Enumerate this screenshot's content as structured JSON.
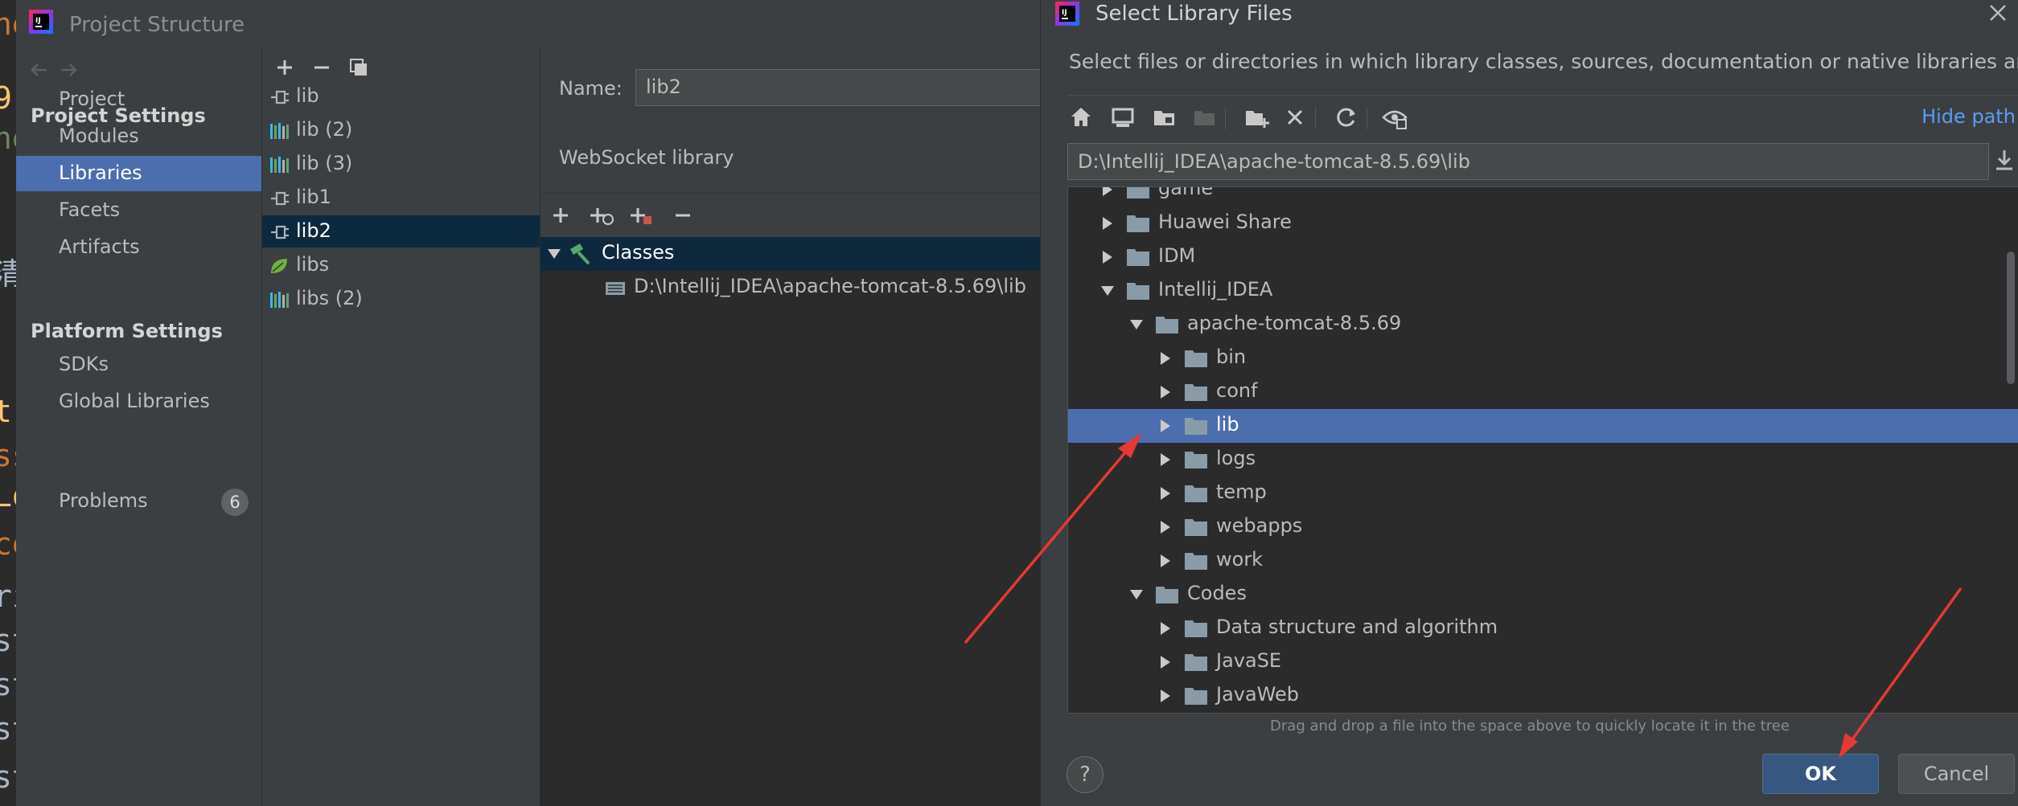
{
  "code_strip": [
    "ne",
    "9.",
    "ne",
    "清",
    "t(",
    "ss",
    "Lo",
    "ce",
    "ri",
    "st",
    "st",
    "st",
    "st"
  ],
  "project_structure": {
    "title": "Project Structure",
    "sidebar": {
      "project_settings_header": "Project Settings",
      "project_settings_items": [
        "Project",
        "Modules",
        "Libraries",
        "Facets",
        "Artifacts"
      ],
      "selected_item": "Libraries",
      "platform_settings_header": "Platform Settings",
      "platform_settings_items": [
        "SDKs",
        "Global Libraries"
      ],
      "problems_label": "Problems",
      "problems_count": "6"
    },
    "libraries": [
      {
        "label": "lib",
        "icon": "plug-icon"
      },
      {
        "label": "lib (2)",
        "icon": "library-icon"
      },
      {
        "label": "lib (3)",
        "icon": "library-icon"
      },
      {
        "label": "lib1",
        "icon": "plug-icon"
      },
      {
        "label": "lib2",
        "icon": "plug-icon"
      },
      {
        "label": "libs",
        "icon": "spring-leaf-icon"
      },
      {
        "label": "libs (2)",
        "icon": "library-icon"
      }
    ],
    "selected_library": "lib2",
    "detail": {
      "name_label": "Name:",
      "name_value": "lib2",
      "type_label": "WebSocket library",
      "classes_label": "Classes",
      "class_path": "D:\\Intellij_IDEA\\apache-tomcat-8.5.69\\lib"
    }
  },
  "dialog": {
    "title": "Select Library Files",
    "description": "Select files or directories in which library classes, sources, documentation or native libraries are located",
    "hide_path": "Hide path",
    "path_value": "D:\\Intellij_IDEA\\apache-tomcat-8.5.69\\lib",
    "tree": [
      {
        "label": "game",
        "depth": 0,
        "expanded": false
      },
      {
        "label": "Huawei Share",
        "depth": 0,
        "expanded": false
      },
      {
        "label": "IDM",
        "depth": 0,
        "expanded": false
      },
      {
        "label": "Intellij_IDEA",
        "depth": 0,
        "expanded": true
      },
      {
        "label": "apache-tomcat-8.5.69",
        "depth": 1,
        "expanded": true
      },
      {
        "label": "bin",
        "depth": 2,
        "expanded": false
      },
      {
        "label": "conf",
        "depth": 2,
        "expanded": false
      },
      {
        "label": "lib",
        "depth": 2,
        "expanded": false,
        "selected": true
      },
      {
        "label": "logs",
        "depth": 2,
        "expanded": false
      },
      {
        "label": "temp",
        "depth": 2,
        "expanded": false
      },
      {
        "label": "webapps",
        "depth": 2,
        "expanded": false
      },
      {
        "label": "work",
        "depth": 2,
        "expanded": false
      },
      {
        "label": "Codes",
        "depth": 1,
        "expanded": true
      },
      {
        "label": "Data structure and algorithm",
        "depth": 2,
        "expanded": false
      },
      {
        "label": "JavaSE",
        "depth": 2,
        "expanded": false
      },
      {
        "label": "JavaWeb",
        "depth": 2,
        "expanded": false
      }
    ],
    "drag_hint": "Drag and drop a file into the space above to quickly locate it in the tree",
    "help_label": "?",
    "ok_label": "OK",
    "cancel_label": "Cancel"
  },
  "colors": {
    "selection": "#4b6eaf",
    "annotation_arrow": "#e53935",
    "accent_link": "#589df6",
    "folder": "#8a9ba8"
  }
}
